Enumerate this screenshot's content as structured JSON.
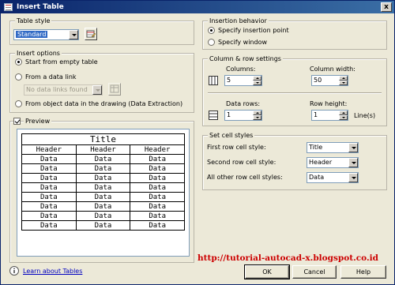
{
  "window": {
    "title": "Insert Table",
    "close_glyph": "x"
  },
  "table_style": {
    "legend": "Table style",
    "value": "Standard"
  },
  "insert_options": {
    "legend": "Insert options",
    "start_empty": "Start from empty table",
    "from_data_link": "From a data link",
    "data_link_value": "No data links found",
    "from_object_data": "From object data in the drawing (Data Extraction)"
  },
  "preview": {
    "label": "Preview",
    "checked": true,
    "title": "Title",
    "headers": [
      "Header",
      "Header",
      "Header"
    ],
    "rows": [
      [
        "Data",
        "Data",
        "Data"
      ],
      [
        "Data",
        "Data",
        "Data"
      ],
      [
        "Data",
        "Data",
        "Data"
      ],
      [
        "Data",
        "Data",
        "Data"
      ],
      [
        "Data",
        "Data",
        "Data"
      ],
      [
        "Data",
        "Data",
        "Data"
      ],
      [
        "Data",
        "Data",
        "Data"
      ],
      [
        "Data",
        "Data",
        "Data"
      ]
    ]
  },
  "insertion_behavior": {
    "legend": "Insertion behavior",
    "specify_point": "Specify insertion point",
    "specify_window": "Specify window"
  },
  "col_row": {
    "legend": "Column & row settings",
    "columns_label": "Columns:",
    "columns_value": "5",
    "column_width_label": "Column width:",
    "column_width_value": "50",
    "data_rows_label": "Data rows:",
    "data_rows_value": "1",
    "row_height_label": "Row height:",
    "row_height_value": "1",
    "lines_label": "Line(s)"
  },
  "cell_styles": {
    "legend": "Set cell styles",
    "first_label": "First row cell style:",
    "first_value": "Title",
    "second_label": "Second row cell style:",
    "second_value": "Header",
    "other_label": "All other row cell styles:",
    "other_value": "Data"
  },
  "footer": {
    "learn_link": "Learn about Tables",
    "ok": "OK",
    "cancel": "Cancel",
    "help": "Help",
    "watermark": "http://tutorial-autocad-x.blogspot.co.id"
  }
}
